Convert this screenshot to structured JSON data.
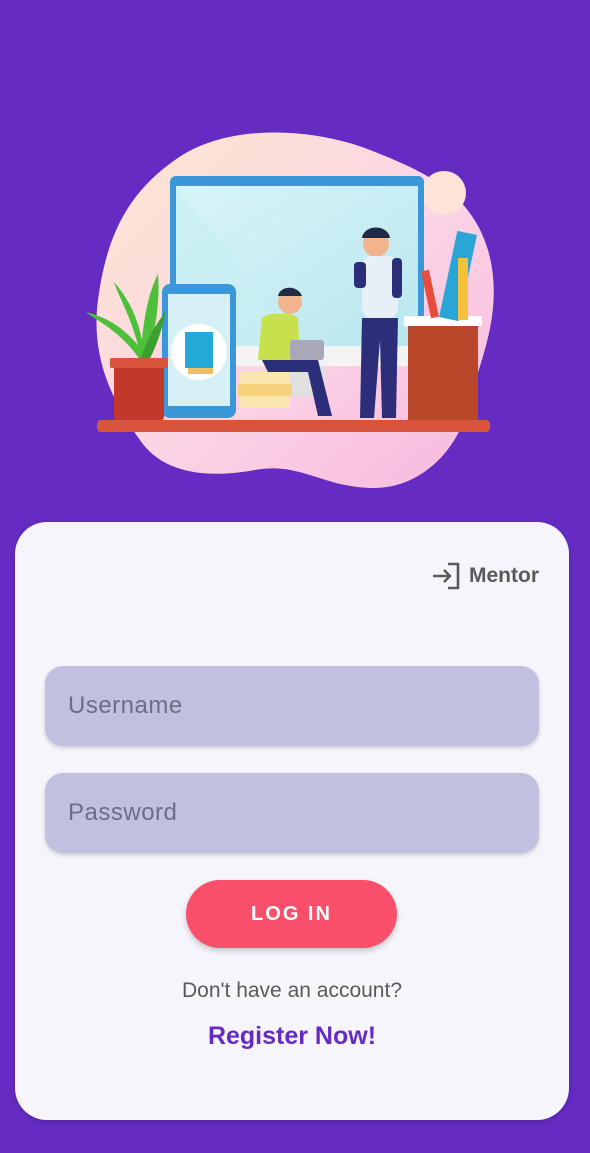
{
  "colors": {
    "background": "#652bc3",
    "card": "#f6f5fb",
    "field": "#c1c0df",
    "primary_button": "#f94f6b",
    "link": "#652bc3"
  },
  "hero": {
    "illustration": "study-workspace-illustration"
  },
  "login_card": {
    "mentor_link": {
      "icon": "login-arrow-icon",
      "label": "Mentor"
    },
    "username": {
      "placeholder": "Username",
      "value": ""
    },
    "password": {
      "placeholder": "Password",
      "value": ""
    },
    "login_button": "LOG IN",
    "no_account_text": "Don't have an account?",
    "register_link": "Register Now!"
  }
}
